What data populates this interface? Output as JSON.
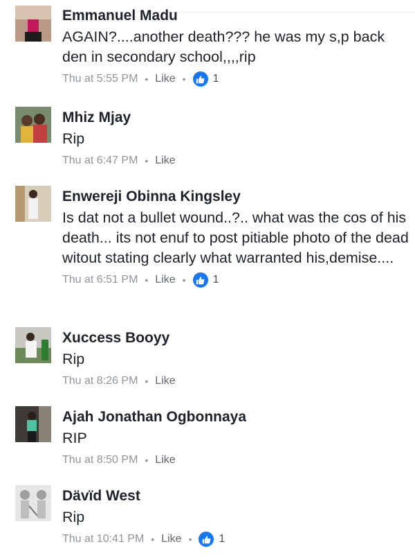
{
  "comments": [
    {
      "name": "Emmanuel Madu",
      "text": "AGAIN?....another death??? he was my s,p back den in secondary school,,,,rip",
      "time": "Thu at 5:55 PM",
      "like_label": "Like",
      "reactions": "1",
      "avatar_icon": "profile-photo"
    },
    {
      "name": "Mhiz Mjay",
      "text": "Rip",
      "time": "Thu at 6:47 PM",
      "like_label": "Like",
      "avatar_icon": "profile-photo"
    },
    {
      "name": "Enwereji Obinna Kingsley",
      "text": "Is dat not a bullet wound..?.. what was the cos of his death... its not enuf to post pitiable photo of the dead witout stating clearly what warranted his,demise....",
      "time": "Thu at 6:51 PM",
      "like_label": "Like",
      "reactions": "1",
      "avatar_icon": "profile-photo"
    },
    {
      "name": "Xuccess Booyy",
      "text": "Rip",
      "time": "Thu at 8:26 PM",
      "like_label": "Like",
      "avatar_icon": "profile-photo"
    },
    {
      "name": "Ajah Jonathan Ogbonnaya",
      "text": "RIP",
      "time": "Thu at 8:50 PM",
      "like_label": "Like",
      "avatar_icon": "profile-photo"
    },
    {
      "name": "Dävïd West",
      "text": "Rip",
      "time": "Thu at 10:41 PM",
      "like_label": "Like",
      "reactions": "1",
      "avatar_icon": "profile-photo"
    }
  ],
  "colors": {
    "name": "#1d2129",
    "meta": "#90949c",
    "like_reaction": "#1877f2"
  }
}
